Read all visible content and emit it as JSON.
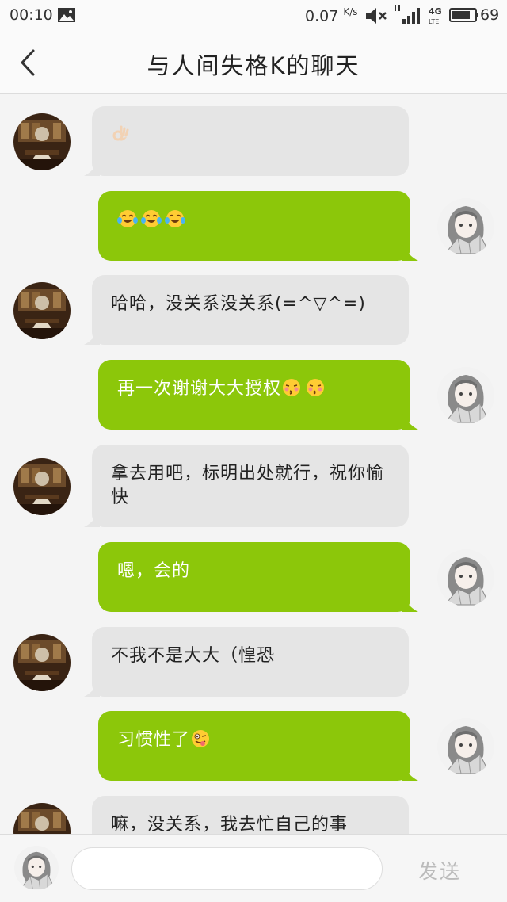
{
  "status_bar": {
    "time": "00:10",
    "speed_value": "0.07",
    "speed_unit": "K/s",
    "network": "4G LTE",
    "battery": "69"
  },
  "header": {
    "title": "与人间失格K的聊天"
  },
  "messages": [
    {
      "side": "in",
      "text": "",
      "emoji": [
        "ok-hand"
      ]
    },
    {
      "side": "out",
      "text": "",
      "emoji": [
        "laughing-tears",
        "laughing-tears",
        "laughing-tears"
      ]
    },
    {
      "side": "in",
      "text": "哈哈，没关系没关系(=^▽^=)",
      "emoji": []
    },
    {
      "side": "out",
      "text": "再一次谢谢大大授权",
      "emoji": [
        "kissing-face",
        "kissing-face"
      ]
    },
    {
      "side": "in",
      "text": "拿去用吧，标明出处就行，祝你愉快",
      "emoji": []
    },
    {
      "side": "out",
      "text": "嗯，会的",
      "emoji": []
    },
    {
      "side": "in",
      "text": "不我不是大大（惶恐",
      "emoji": []
    },
    {
      "side": "out",
      "text": "习惯性了",
      "emoji": [
        "winking-tongue"
      ]
    },
    {
      "side": "in",
      "text": "嘛，没关系，我去忙自己的事",
      "emoji": []
    }
  ],
  "input": {
    "value": "",
    "placeholder": ""
  },
  "send_label": "发送",
  "colors": {
    "outgoing_bubble": "#8cc70a",
    "incoming_bubble": "#e5e5e5",
    "background": "#f4f4f4"
  },
  "icons": {
    "back": "chevron-left-icon",
    "gallery": "gallery-icon",
    "mute": "mute-icon",
    "signal": "signal-icon",
    "battery": "battery-icon"
  }
}
